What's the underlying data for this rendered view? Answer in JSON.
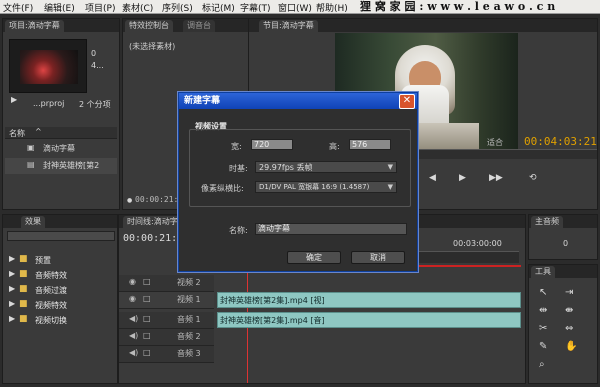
{
  "menu": [
    "文件(F)",
    "编辑(E)",
    "项目(P)",
    "素材(C)",
    "序列(S)",
    "标记(M)",
    "字幕(T)",
    "窗口(W)",
    "帮助(H)"
  ],
  "watermark": "狸 窝 家 园 : w w w . l e a w o . c n",
  "project": {
    "tab": "项目:滴动字幕",
    "file_label": "...prproj",
    "item_count": "2 个分项",
    "thumb_info": [
      "0",
      "4..."
    ],
    "name_header": "名称",
    "items": [
      "滴动字幕",
      "封神英雄榜[第2"
    ]
  },
  "source": {
    "tabs": [
      "特效控制台",
      "调音台"
    ],
    "text": "(未选择素材)",
    "timecode": "00:00:21:13"
  },
  "program": {
    "tab": "节目:滴动字幕",
    "timecode": "00:04:03:21",
    "fit": "适合"
  },
  "effects": {
    "tab": "效果",
    "items": [
      "预置",
      "音频特效",
      "音频过渡",
      "视频特效",
      "视频切换"
    ]
  },
  "timeline": {
    "tab": "时间线:滴动字幕",
    "timecode": "00:00:21:13",
    "ruler": "00:03:00:00",
    "tracks": [
      {
        "name": "视频 2",
        "clip": ""
      },
      {
        "name": "视频 1",
        "clip": "封神英雄榜[第2集].mp4 [视]"
      },
      {
        "name": "音频 1",
        "clip": "封神英雄榜[第2集].mp4 [音]"
      },
      {
        "name": "音频 2",
        "clip": ""
      },
      {
        "name": "音频 3",
        "clip": ""
      }
    ]
  },
  "audio_panel": {
    "tab": "主音频",
    "value": "0"
  },
  "tools_panel": {
    "tab": "工具"
  },
  "dialog": {
    "title": "新建字幕",
    "close": "✕",
    "section": "视频设置",
    "width_label": "宽:",
    "width_value": "720",
    "height_label": "高:",
    "height_value": "576",
    "timebase_label": "时基:",
    "timebase_value": "29.97fps 丢帧",
    "par_label": "像素纵横比:",
    "par_value": "D1/DV PAL 宽银幕 16:9 (1.4587)",
    "name_label": "名称:",
    "name_value": "滴动字幕",
    "ok": "确定",
    "cancel": "取消"
  },
  "colors": {
    "accent_timecode": "#e0a000",
    "dialog_title": "#1f55c9",
    "clip": "#8ec7c2"
  }
}
